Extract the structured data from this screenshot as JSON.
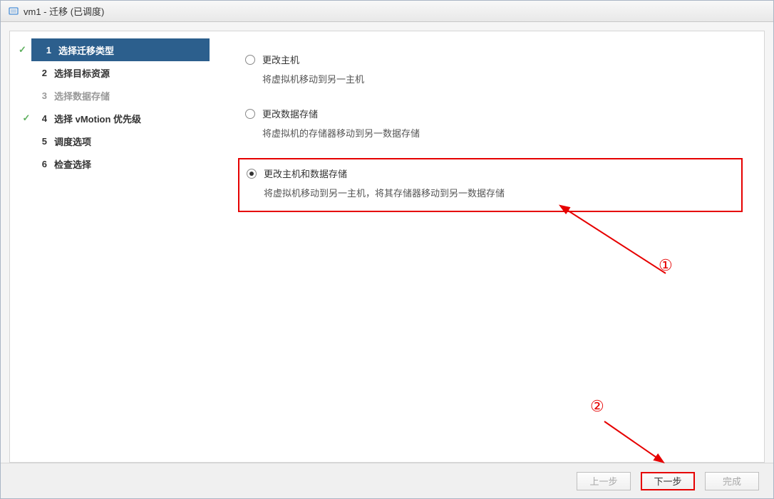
{
  "window": {
    "title": "vm1 - 迁移 (已调度)"
  },
  "steps": [
    {
      "num": "1",
      "label": "选择迁移类型",
      "state": "active",
      "checked": true
    },
    {
      "num": "2",
      "label": "选择目标资源",
      "state": "pending",
      "checked": false
    },
    {
      "num": "3",
      "label": "选择数据存储",
      "state": "disabled",
      "checked": false
    },
    {
      "num": "4",
      "label": "选择 vMotion 优先级",
      "state": "pending",
      "checked": true
    },
    {
      "num": "5",
      "label": "调度选项",
      "state": "pending",
      "checked": false
    },
    {
      "num": "6",
      "label": "检查选择",
      "state": "pending",
      "checked": false
    }
  ],
  "options": [
    {
      "title": "更改主机",
      "desc": "将虚拟机移动到另一主机",
      "selected": false
    },
    {
      "title": "更改数据存储",
      "desc": "将虚拟机的存储器移动到另一数据存储",
      "selected": false
    },
    {
      "title": "更改主机和数据存储",
      "desc": "将虚拟机移动到另一主机，将其存储器移动到另一数据存储",
      "selected": true
    }
  ],
  "buttons": {
    "back": "上一步",
    "next": "下一步",
    "finish": "完成"
  },
  "annotations": {
    "a1": "①",
    "a2": "②"
  }
}
